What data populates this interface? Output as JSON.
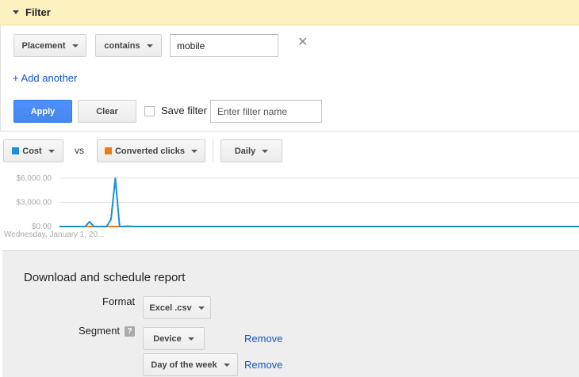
{
  "filter": {
    "title": "Filter",
    "field_dropdown": "Placement",
    "operator_dropdown": "contains",
    "value": "mobile",
    "add_another_label": "+ Add another",
    "apply_label": "Apply",
    "clear_label": "Clear",
    "save_filter_label": "Save filter",
    "filter_name_placeholder": "Enter filter name",
    "save_filter_checked": false
  },
  "chart_controls": {
    "metric1": {
      "label": "Cost",
      "color": "#1a8fd3"
    },
    "vs_label": "vs",
    "metric2": {
      "label": "Converted clicks",
      "color": "#ee7a1a"
    },
    "period": "Daily"
  },
  "chart_data": {
    "type": "line",
    "ytick_labels": [
      "$6,000.00",
      "$3,000.00",
      "$0.00"
    ],
    "ylim": [
      0,
      6000
    ],
    "x_start_label": "Wednesday, January 1, 20...",
    "grid": true,
    "series": [
      {
        "name": "Cost",
        "color": "#1a8fd3",
        "values": [
          0,
          0,
          0,
          0,
          0,
          0,
          0,
          600,
          0,
          0,
          0,
          0,
          900,
          6000,
          0,
          0,
          50,
          0,
          0,
          0,
          0,
          0,
          0,
          0,
          0,
          0,
          0,
          0,
          0,
          0,
          0,
          0,
          0,
          0,
          0,
          0,
          0,
          0,
          0,
          0,
          0,
          0,
          0,
          0,
          0,
          0,
          0,
          0,
          0,
          0,
          0,
          0,
          0,
          0,
          0,
          0,
          0,
          0,
          0,
          0,
          0,
          0,
          0,
          0,
          0,
          0,
          0,
          0,
          0,
          0,
          0,
          0,
          0,
          0,
          0,
          0,
          0,
          0,
          0,
          0,
          0,
          0,
          0,
          0,
          0,
          0,
          0,
          0,
          0,
          0,
          0,
          0,
          0,
          0,
          0,
          0,
          0,
          0,
          0,
          0,
          0,
          0,
          0,
          0,
          0,
          0,
          0,
          0,
          0,
          0,
          0,
          0,
          0,
          0,
          0,
          0,
          0,
          0,
          0,
          0,
          0,
          0
        ]
      },
      {
        "name": "Converted clicks",
        "color": "#ee7a1a",
        "values": [
          0,
          0,
          0,
          0,
          0,
          0,
          0,
          0,
          0,
          0,
          0,
          0,
          0,
          0,
          0,
          0,
          0,
          0,
          0,
          0,
          0,
          0,
          0,
          0,
          0,
          0,
          0,
          0,
          0,
          0,
          0,
          0,
          0,
          0,
          0,
          0,
          0,
          0,
          0,
          0,
          0,
          0,
          0,
          0,
          0,
          0,
          0,
          0,
          0,
          0,
          0,
          0,
          0,
          0,
          0,
          0,
          0,
          0,
          0,
          0,
          0,
          0,
          0,
          0,
          0,
          0,
          0,
          0,
          0,
          0,
          0,
          0,
          0,
          0,
          0,
          0,
          0,
          0,
          0,
          0,
          0,
          0,
          0,
          0,
          0,
          0,
          0,
          0,
          0,
          0,
          0,
          0,
          0,
          0,
          0,
          0,
          0,
          0,
          0,
          0,
          0,
          0,
          0,
          0,
          0,
          0,
          0,
          0,
          0,
          0,
          0,
          0,
          0,
          0,
          0,
          0,
          0,
          0,
          0,
          0,
          0,
          0
        ]
      }
    ]
  },
  "download": {
    "title": "Download and schedule report",
    "format_label": "Format",
    "format_value": "Excel .csv",
    "segment_label": "Segment",
    "help_icon": "?",
    "segments": [
      {
        "value": "Device",
        "remove_label": "Remove"
      },
      {
        "value": "Day of the week",
        "remove_label": "Remove"
      }
    ]
  }
}
